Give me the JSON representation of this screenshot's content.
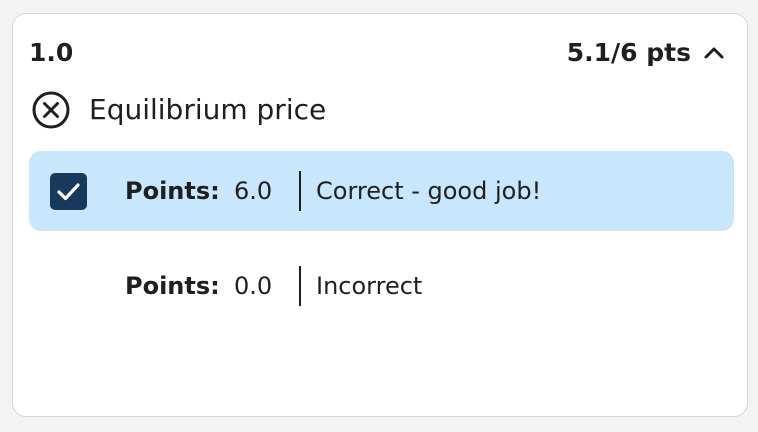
{
  "question": {
    "number": "1.0",
    "score": "5.1/6 pts",
    "collapse_icon": "chevron-up-icon"
  },
  "criterion": {
    "status_icon": "circle-x-icon",
    "title": "Equilibrium price"
  },
  "ratings": [
    {
      "points_label": "Points:",
      "points_value": "6.0",
      "description": "Correct - good job!",
      "selected": true
    },
    {
      "points_label": "Points:",
      "points_value": "0.0",
      "description": "Incorrect",
      "selected": false
    }
  ],
  "colors": {
    "selected_background": "#c8e6fc",
    "checkbox": "#173a5c",
    "text": "#1f1f1f"
  }
}
